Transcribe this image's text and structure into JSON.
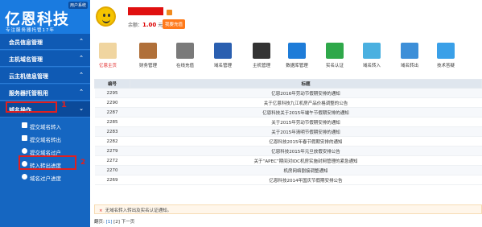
{
  "logo": {
    "badge": "用户系统",
    "name": "亿恩科技",
    "slogan": "专注服务器托管17年"
  },
  "menu": [
    {
      "label": "会员信息管理",
      "expanded": false
    },
    {
      "label": "主机域名管理",
      "expanded": false
    },
    {
      "label": "云主机信息管理",
      "expanded": false
    },
    {
      "label": "服务器托管租用",
      "expanded": false
    },
    {
      "label": "域名操作",
      "expanded": true
    }
  ],
  "submenu": [
    "提交域名转入",
    "提交域名转出",
    "提交域名过户",
    "转入转出进度",
    "域名过户进度"
  ],
  "markers": {
    "one": "1",
    "two": "2"
  },
  "account": {
    "balance_label": "余额：",
    "balance": "1.00",
    "unit": "元",
    "recharge_label": "我要充值"
  },
  "toolbar": [
    "亿恩主页",
    "财务管理",
    "在线充值",
    "域名管理",
    "主机管理",
    "数据库管理",
    "实名认证",
    "域名转入",
    "域名转出",
    "技术答疑"
  ],
  "table": {
    "headers": [
      "编号",
      "标题"
    ],
    "rows": [
      {
        "id": "2295",
        "title": "亿恩2016年劳动节假期安排的通知"
      },
      {
        "id": "2290",
        "title": "关于亿恩科技九江机房产品价格调整的公告"
      },
      {
        "id": "2287",
        "title": "亿恩科技关于2015年端午节假期安排的通知"
      },
      {
        "id": "2285",
        "title": "关于2015年劳动节假期安排的通知"
      },
      {
        "id": "2283",
        "title": "关于2015年清明节假期安排的通知"
      },
      {
        "id": "2282",
        "title": "亿恩科技2015年春节假期安排的通知"
      },
      {
        "id": "2279",
        "title": "亿恩科技2015年元旦放假安排公告"
      },
      {
        "id": "2272",
        "title": "关于“APEC”期间对IDC机房实施封网管理的紧急通知"
      },
      {
        "id": "2270",
        "title": "机房网络割接调整通知"
      },
      {
        "id": "2269",
        "title": "亿恩科技2014年国庆节假期安排公告"
      }
    ]
  },
  "notice": {
    "icon": "×",
    "text": "无域名转入转出及实名认证通知。"
  },
  "pager": {
    "label": "翻页:",
    "p1": "[1]",
    "p2": "[2]",
    "next": "下一页"
  }
}
